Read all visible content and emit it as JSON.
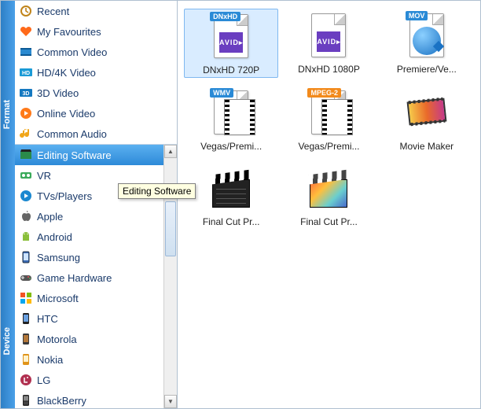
{
  "tabs": {
    "format": "Format",
    "device": "Device"
  },
  "sidebar_top": [
    {
      "label": "Recent",
      "icon": "clock"
    },
    {
      "label": "My Favourites",
      "icon": "heart"
    },
    {
      "label": "Common Video",
      "icon": "cvideo"
    },
    {
      "label": "HD/4K Video",
      "icon": "hd"
    },
    {
      "label": "3D Video",
      "icon": "3d"
    },
    {
      "label": "Online Video",
      "icon": "online"
    },
    {
      "label": "Common Audio",
      "icon": "audio"
    }
  ],
  "sidebar_scroll": [
    {
      "label": "Editing Software",
      "icon": "edit",
      "selected": true
    },
    {
      "label": "VR",
      "icon": "vr"
    },
    {
      "label": "TVs/Players",
      "icon": "tv"
    },
    {
      "label": "Apple",
      "icon": "apple"
    },
    {
      "label": "Android",
      "icon": "android"
    },
    {
      "label": "Samsung",
      "icon": "samsung"
    },
    {
      "label": "Game Hardware",
      "icon": "game"
    },
    {
      "label": "Microsoft",
      "icon": "microsoft"
    },
    {
      "label": "HTC",
      "icon": "htc"
    },
    {
      "label": "Motorola",
      "icon": "motorola"
    },
    {
      "label": "Nokia",
      "icon": "nokia"
    },
    {
      "label": "LG",
      "icon": "lg"
    },
    {
      "label": "BlackBerry",
      "icon": "blackberry"
    }
  ],
  "tooltip": "Editing Software",
  "grid": [
    {
      "label": "DNxHD 720P",
      "type": "avid",
      "badge": "DNxHD",
      "selected": true
    },
    {
      "label": "DNxHD 1080P",
      "type": "avid"
    },
    {
      "label": "Premiere/Ve...",
      "type": "qt",
      "badge": "MOV"
    },
    {
      "label": "Vegas/Premi...",
      "type": "film",
      "badge": "WMV"
    },
    {
      "label": "Vegas/Premi...",
      "type": "film",
      "badge": "MPEG-2",
      "badgecolor": "orange"
    },
    {
      "label": "Movie Maker",
      "type": "mm"
    },
    {
      "label": "Final Cut Pr...",
      "type": "clap-dark"
    },
    {
      "label": "Final Cut Pr...",
      "type": "clap-color"
    }
  ]
}
